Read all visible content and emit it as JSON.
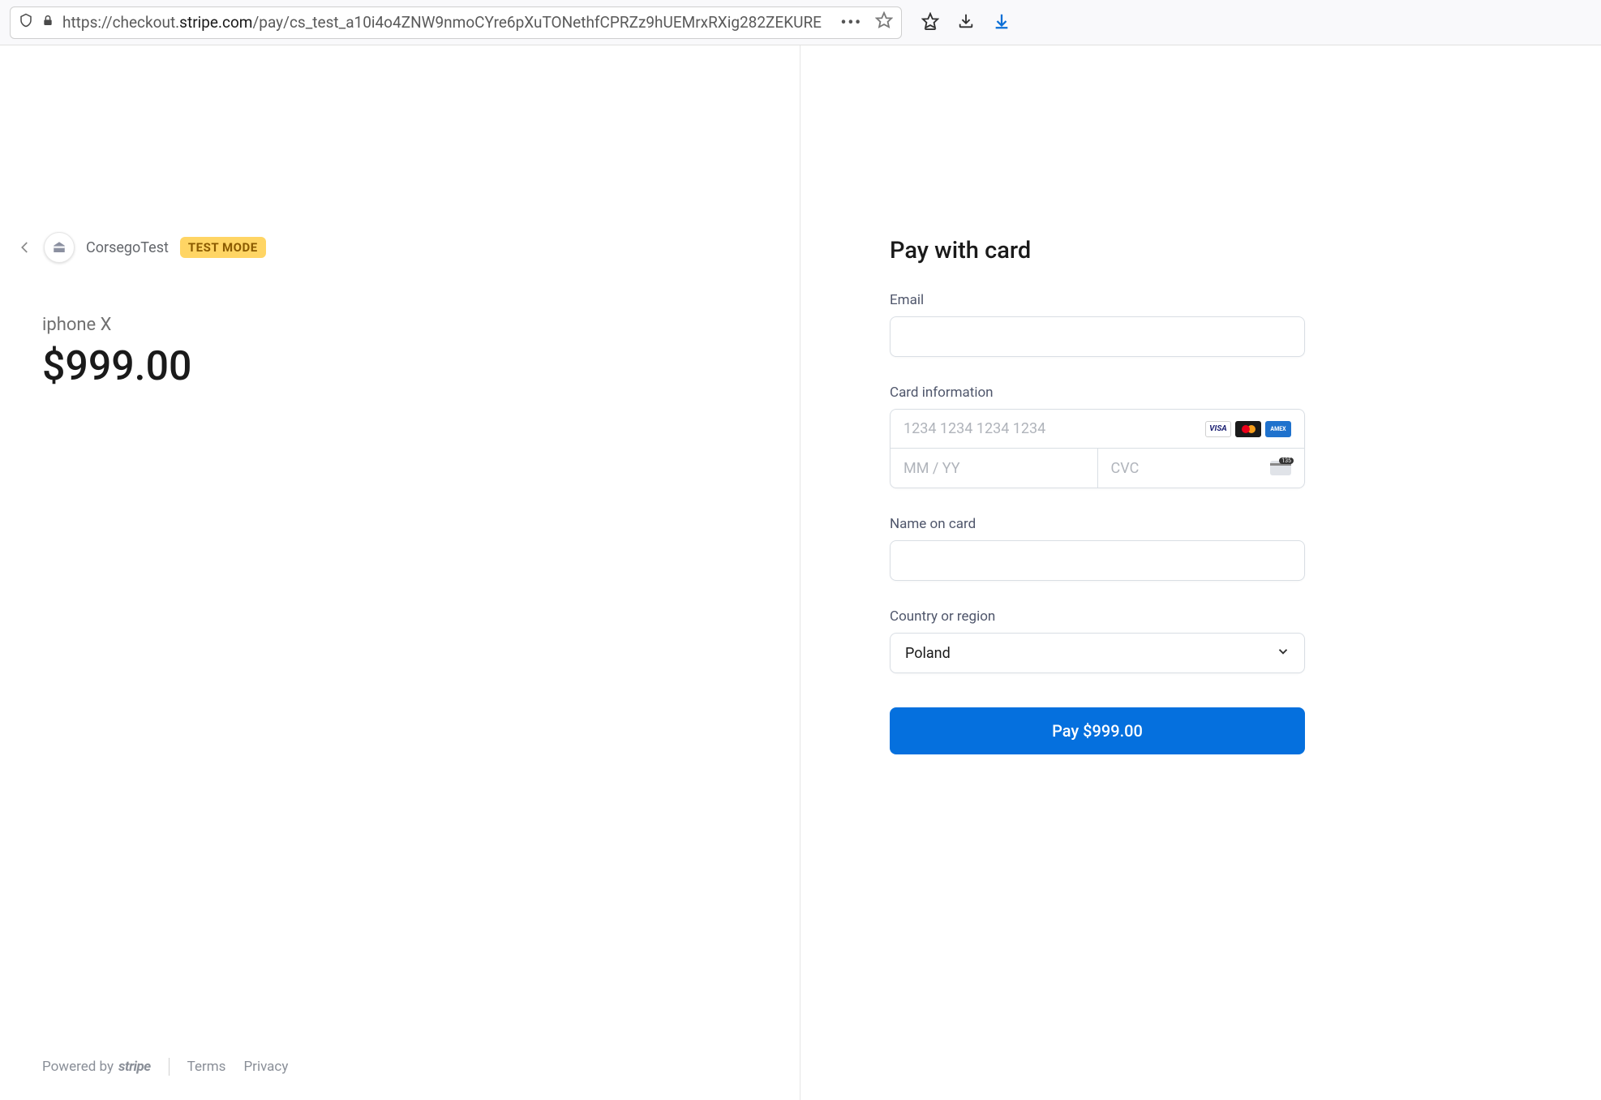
{
  "browser": {
    "url_prefix": "https://checkout.",
    "url_domain": "stripe.com",
    "url_path": "/pay/cs_test_a10i4o4ZNW9nmoCYre6pXuTONethfCPRZz9hUEMrxRXig282ZEKURE"
  },
  "merchant": {
    "name": "CorsegoTest",
    "badge": "TEST MODE"
  },
  "product": {
    "name": "iphone X",
    "price": "$999.00"
  },
  "form": {
    "title": "Pay with card",
    "email_label": "Email",
    "card_label": "Card information",
    "card_number_placeholder": "1234 1234 1234 1234",
    "expiry_placeholder": "MM / YY",
    "cvc_placeholder": "CVC",
    "cvc_tag": "135",
    "name_label": "Name on card",
    "country_label": "Country or region",
    "country_value": "Poland",
    "pay_button": "Pay $999.00",
    "brands": {
      "visa": "VISA",
      "amex": "AMEX"
    }
  },
  "footer": {
    "powered": "Powered by",
    "stripe": "stripe",
    "terms": "Terms",
    "privacy": "Privacy"
  }
}
